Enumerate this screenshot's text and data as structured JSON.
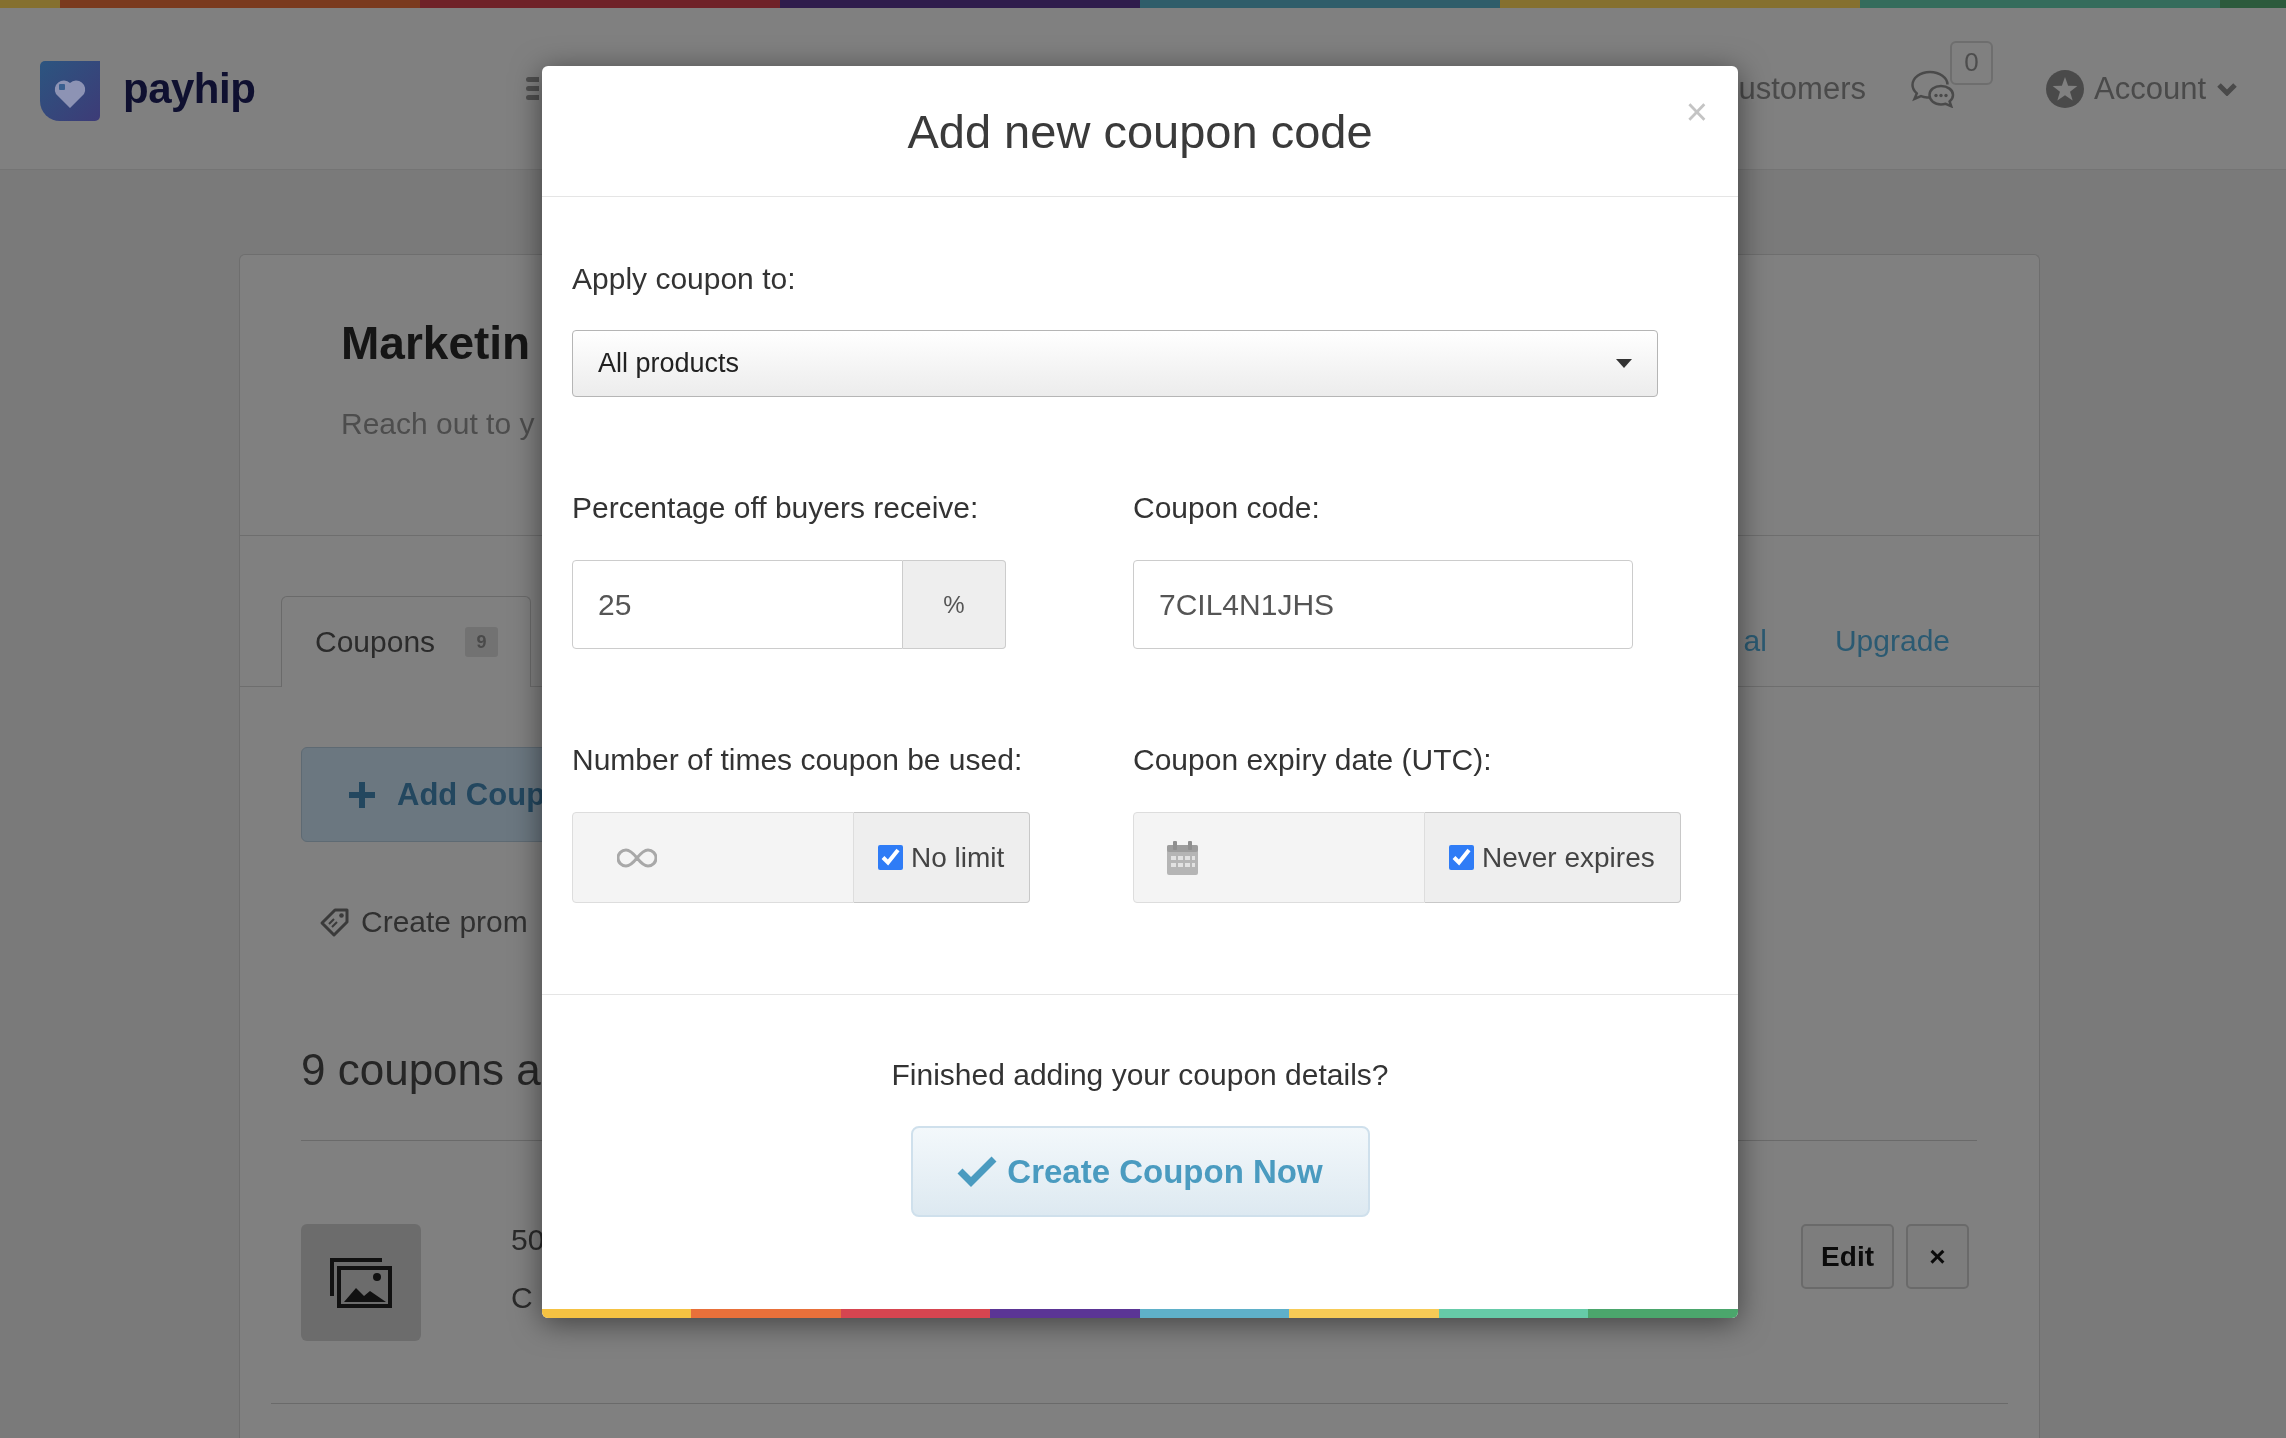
{
  "header": {
    "brand": "payhip",
    "nav": [
      {
        "label": "ustomers"
      }
    ],
    "notifications": {
      "count": "0"
    },
    "account": {
      "label": "Account"
    }
  },
  "page": {
    "title": "Marketin",
    "subtitle": "Reach out to y",
    "tabs": [
      {
        "label": "Coupons",
        "count": "9",
        "selected": true
      },
      {
        "label": "al",
        "selected": false
      },
      {
        "label": "Upgrade",
        "selected": false
      }
    ],
    "add_button": "Add Coup",
    "promo_link": "Create prom",
    "list_heading": "9 coupons a",
    "coupons": [
      {
        "lines": [
          "50",
          "C"
        ],
        "actions": [
          "Edit",
          "×"
        ]
      }
    ]
  },
  "modal": {
    "title": "Add new coupon code",
    "close": "×",
    "apply_to": {
      "label": "Apply coupon to:",
      "value": "All products"
    },
    "percentage": {
      "label": "Percentage off buyers receive:",
      "value": "25",
      "unit": "%"
    },
    "code": {
      "label": "Coupon code:",
      "value": "7CIL4N1JHS"
    },
    "usage_limit": {
      "label": "Number of times coupon be used:",
      "option": "No limit",
      "checked": true
    },
    "expiry": {
      "label": "Coupon expiry date (UTC):",
      "option": "Never expires",
      "checked": true
    },
    "prompt": "Finished adding your coupon details?",
    "submit": "Create Coupon Now"
  }
}
